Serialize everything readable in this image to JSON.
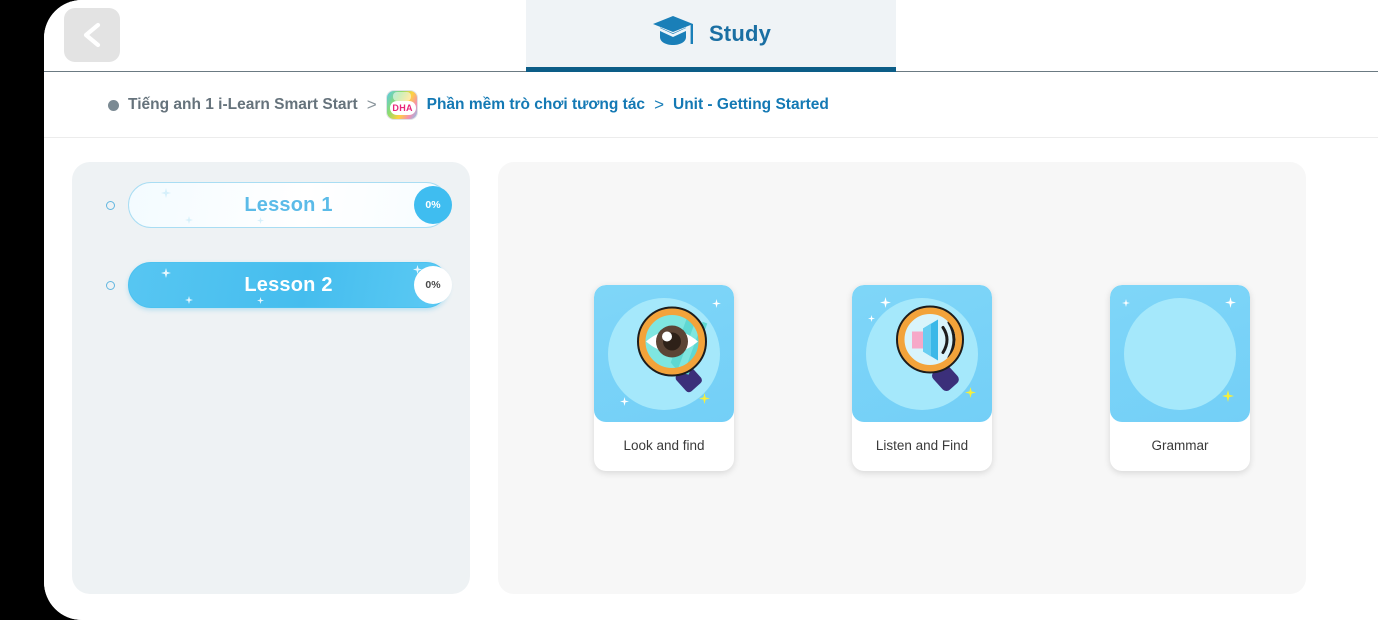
{
  "header": {
    "back_button_label": "Back",
    "back_icon": "chevron-left-icon",
    "tab": {
      "label": "Study",
      "icon": "graduation-cap-icon",
      "active": true,
      "accent_color": "#0c5d87",
      "background_color": "#eff3f6"
    }
  },
  "breadcrumb": {
    "root": "Tiếng anh 1 i-Learn Smart Start",
    "separator_1": ">",
    "app_icon_text": "DHA",
    "link": "Phần mềm trò chơi tương tác",
    "separator_2": ">",
    "current": "Unit - Getting Started",
    "link_color": "#1479b4",
    "root_color": "#66737c"
  },
  "lessons": {
    "panel_background": "#eef2f4",
    "items": [
      {
        "label": "Lesson 1",
        "progress": "0%",
        "selected": false
      },
      {
        "label": "Lesson 2",
        "progress": "0%",
        "selected": true
      }
    ]
  },
  "activities": {
    "panel_background": "#f7f7f7",
    "cards": [
      {
        "label": "Look and find",
        "icon": "magnifier-eye-icon",
        "loaded": true
      },
      {
        "label": "Listen and Find",
        "icon": "magnifier-speaker-icon",
        "loaded": true
      },
      {
        "label": "Grammar",
        "icon": "placeholder-circle-icon",
        "loaded": false
      }
    ]
  },
  "colors": {
    "primary_blue": "#1479b4",
    "tab_underline": "#0c5d87",
    "lesson_active": "#4cc2f0",
    "card_thumb": "#7fd6f8",
    "sparkle_yellow": "#f7ef3a"
  }
}
